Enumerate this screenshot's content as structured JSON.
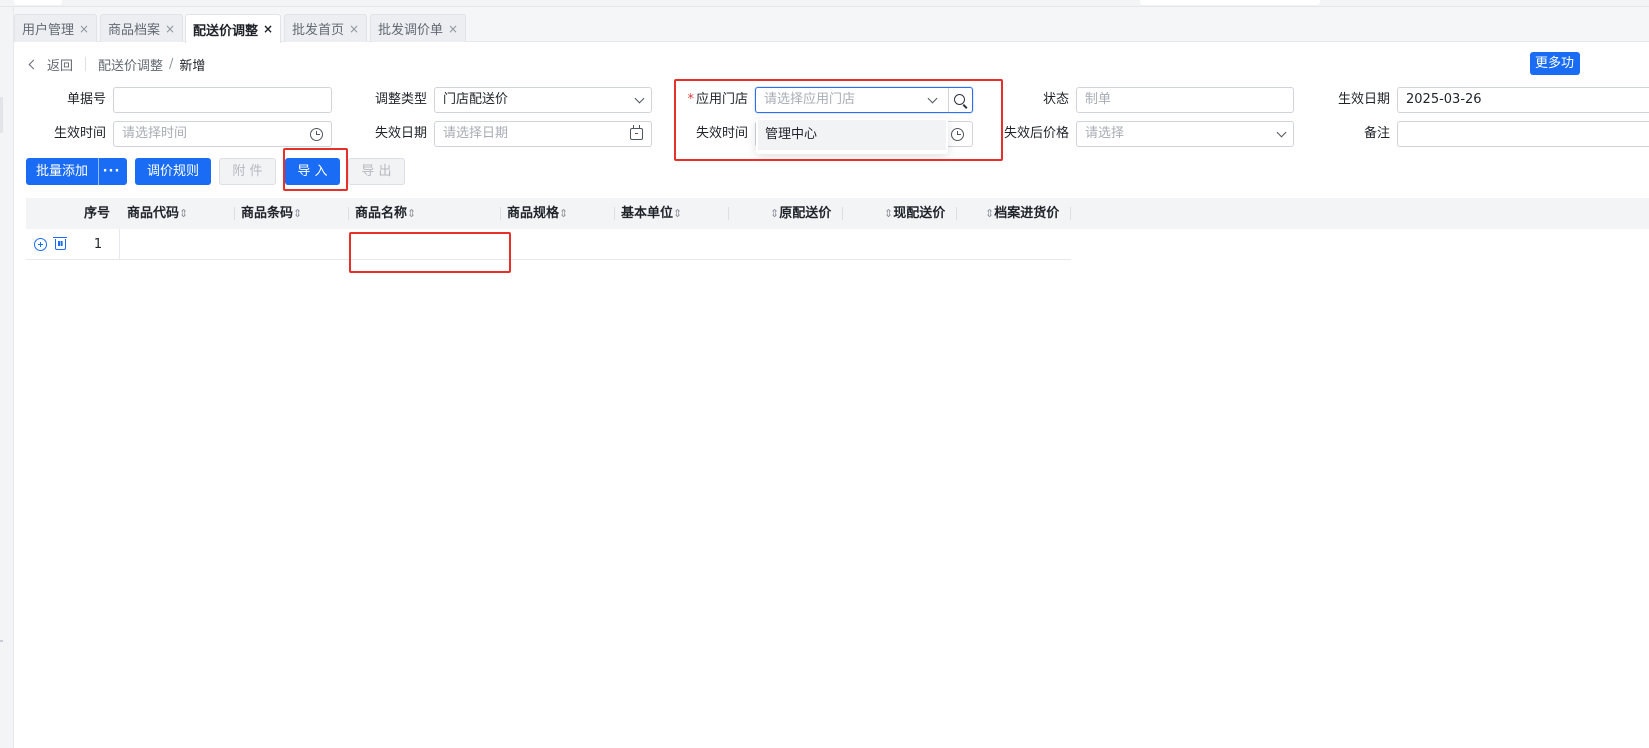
{
  "tabs": [
    {
      "label": "用户管理",
      "active": false
    },
    {
      "label": "商品档案",
      "active": false
    },
    {
      "label": "配送价调整",
      "active": true
    },
    {
      "label": "批发首页",
      "active": false
    },
    {
      "label": "批发调价单",
      "active": false
    }
  ],
  "tab_close_glyph": "×",
  "breadcrumb": {
    "back": "返回",
    "parent": "配送价调整",
    "separator": "/",
    "current": "新增"
  },
  "more_button": "更多功",
  "form": {
    "doc_no": {
      "label": "单据号",
      "value": ""
    },
    "adjust_type": {
      "label": "调整类型",
      "value": "门店配送价"
    },
    "apply_store": {
      "required_mark": "*",
      "label": "应用门店",
      "placeholder": "请选择应用门店"
    },
    "status": {
      "label": "状态",
      "placeholder": "制单"
    },
    "effective_date": {
      "label": "生效日期",
      "value": "2025-03-26"
    },
    "effective_time": {
      "label": "生效时间",
      "placeholder": "请选择时间"
    },
    "expire_date": {
      "label": "失效日期",
      "placeholder": "请选择日期"
    },
    "expire_time": {
      "label": "失效时间"
    },
    "price_after_expire": {
      "label": "失效后价格",
      "placeholder": "请选择"
    },
    "remark": {
      "label": "备注",
      "value": ""
    }
  },
  "store_dropdown": {
    "options": [
      "管理中心"
    ]
  },
  "toolbar": {
    "batch_add": "批量添加",
    "more": "···",
    "price_rule": "调价规则",
    "attachment": "附 件",
    "import": "导 入",
    "export": "导 出"
  },
  "table": {
    "columns": {
      "seq": "序号",
      "code": "商品代码",
      "barcode": "商品条码",
      "name": "商品名称",
      "spec": "商品规格",
      "unit": "基本单位",
      "orig_price": "原配送价",
      "new_price": "现配送价",
      "purchase_price": "档案进货价"
    },
    "sort_glyph": "⇕",
    "rows": [
      {
        "seq": "1"
      }
    ]
  },
  "colors": {
    "primary": "#1a6cf5",
    "highlight_box": "#e8302a",
    "required": "#e23b3b"
  },
  "icons": [
    "back-icon",
    "chevron-down-icon",
    "search-icon",
    "clock-icon",
    "calendar-icon",
    "add-circle-icon",
    "trash-icon",
    "close-icon",
    "sort-icon"
  ]
}
